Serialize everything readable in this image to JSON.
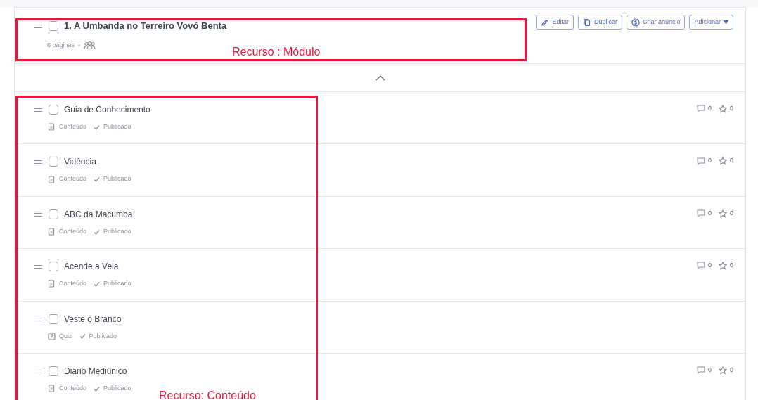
{
  "module": {
    "title": "1. A Umbanda no Terreiro Vovó Benta",
    "checked": false,
    "pages": "6 páginas",
    "actions": [
      {
        "kind": "edit",
        "label": "Editar"
      },
      {
        "kind": "duplicate",
        "label": "Duplicar"
      },
      {
        "kind": "ad",
        "label": "Criar anúncio"
      },
      {
        "kind": "dropdown",
        "label": "Adicionar"
      }
    ]
  },
  "expanded": true,
  "items": [
    {
      "title": "Guia de Conhecimento",
      "checked": false,
      "kind": "content",
      "type_label": "Conteúdo",
      "status": "Publicado",
      "comments": "0",
      "stars_count": "0"
    },
    {
      "title": "Vidência",
      "checked": false,
      "kind": "content",
      "type_label": "Conteúdo",
      "status": "Publicado",
      "comments": "0",
      "stars_count": "0"
    },
    {
      "title": "ABC da Macumba",
      "checked": false,
      "kind": "content",
      "type_label": "Conteúdo",
      "status": "Publicado",
      "comments": "0",
      "stars_count": "0"
    },
    {
      "title": "Acende a Vela",
      "checked": false,
      "kind": "content",
      "type_label": "Conteúdo",
      "status": "Publicado",
      "comments": "0",
      "stars_count": "0"
    },
    {
      "title": "Veste o Branco",
      "checked": false,
      "kind": "quiz",
      "type_label": "Quiz",
      "status": "Publicado"
    },
    {
      "title": "Diário Mediúnico",
      "checked": false,
      "kind": "content",
      "type_label": "Conteúdo",
      "status": "Publicado",
      "comments": "0",
      "stars_count": "0"
    }
  ],
  "annotations": [
    {
      "kind": "module",
      "label": "Recurso : Módulo"
    },
    {
      "kind": "content",
      "label": "Recurso: Conteúdo"
    }
  ]
}
